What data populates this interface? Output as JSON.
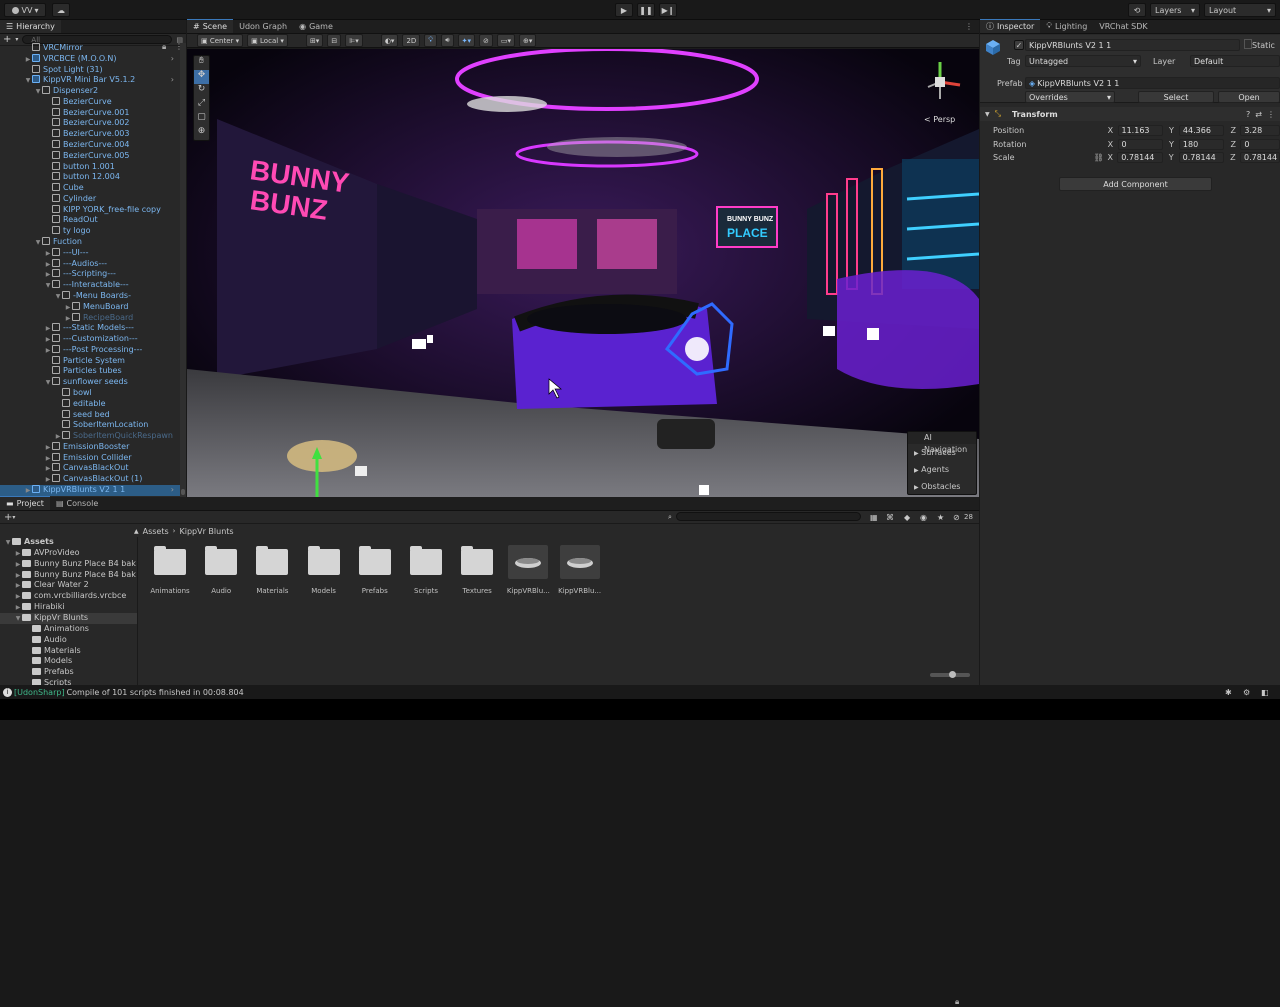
{
  "topbar": {
    "account": "VV",
    "layers": "Layers",
    "layout": "Layout"
  },
  "hierarchy": {
    "tab": "Hierarchy",
    "search_placeholder": "All",
    "items": [
      {
        "label": "VRCMirror",
        "indent": 3
      },
      {
        "label": "VRCBCE (M.O.O.N)",
        "indent": 3,
        "prefab": true,
        "arrow": "▶"
      },
      {
        "label": "Spot Light (31)",
        "indent": 3
      },
      {
        "label": "KippVR Mini Bar V5.1.2",
        "indent": 3,
        "prefab": true,
        "arrow": "▼"
      },
      {
        "label": "Dispenser2",
        "indent": 4,
        "arrow": "▼"
      },
      {
        "label": "BezierCurve",
        "indent": 5
      },
      {
        "label": "BezierCurve.001",
        "indent": 5
      },
      {
        "label": "BezierCurve.002",
        "indent": 5
      },
      {
        "label": "BezierCurve.003",
        "indent": 5
      },
      {
        "label": "BezierCurve.004",
        "indent": 5
      },
      {
        "label": "BezierCurve.005",
        "indent": 5
      },
      {
        "label": "button 1.001",
        "indent": 5
      },
      {
        "label": "button 12.004",
        "indent": 5
      },
      {
        "label": "Cube",
        "indent": 5
      },
      {
        "label": "Cylinder",
        "indent": 5
      },
      {
        "label": "KIPP YORK_free-file copy",
        "indent": 5
      },
      {
        "label": "ReadOut",
        "indent": 5
      },
      {
        "label": "ty logo",
        "indent": 5
      },
      {
        "label": "Fuction",
        "indent": 4,
        "arrow": "▼"
      },
      {
        "label": "---UI---",
        "indent": 5,
        "arrow": "▶"
      },
      {
        "label": "---Audios---",
        "indent": 5,
        "arrow": "▶"
      },
      {
        "label": "---Scripting---",
        "indent": 5,
        "arrow": "▶"
      },
      {
        "label": "---Interactable---",
        "indent": 5,
        "arrow": "▼"
      },
      {
        "label": "-Menu Boards-",
        "indent": 6,
        "arrow": "▼"
      },
      {
        "label": "MenuBoard",
        "indent": 7,
        "arrow": "▶"
      },
      {
        "label": "RecipeBoard",
        "indent": 7,
        "arrow": "▶",
        "dim": true
      },
      {
        "label": "---Static Models---",
        "indent": 5,
        "arrow": "▶"
      },
      {
        "label": "---Customization---",
        "indent": 5,
        "arrow": "▶"
      },
      {
        "label": "---Post Processing---",
        "indent": 5,
        "arrow": "▶"
      },
      {
        "label": "Particle System",
        "indent": 5
      },
      {
        "label": "Particles tubes",
        "indent": 5
      },
      {
        "label": "sunflower seeds",
        "indent": 5,
        "arrow": "▼"
      },
      {
        "label": "bowl",
        "indent": 6
      },
      {
        "label": "editable",
        "indent": 6
      },
      {
        "label": "seed bed",
        "indent": 6
      },
      {
        "label": "SoberItemLocation",
        "indent": 6
      },
      {
        "label": "SoberItemQuickRespawn",
        "indent": 6,
        "arrow": "▶",
        "dim": true
      },
      {
        "label": "EmissionBooster",
        "indent": 5,
        "arrow": "▶"
      },
      {
        "label": "Emission Collider",
        "indent": 5,
        "arrow": "▶"
      },
      {
        "label": "CanvasBlackOut",
        "indent": 5,
        "arrow": "▶"
      },
      {
        "label": "CanvasBlackOut (1)",
        "indent": 5,
        "arrow": "▶"
      },
      {
        "label": "KippVRBlunts V2 1 1",
        "indent": 3,
        "prefab": true,
        "arrow": "▶",
        "selected": true
      }
    ]
  },
  "scene": {
    "tabs": [
      "Scene",
      "Udon Graph",
      "Game"
    ],
    "pivot": "Center",
    "space": "Local",
    "mode2d": "2D",
    "persp": "< Persp",
    "overlay_title": "AI Navigation",
    "overlay_items": [
      "Surfaces",
      "Agents",
      "Obstacles"
    ],
    "signs": [
      "BUNNY",
      "BUNZ",
      "BUNNY BUNZ",
      "PLACE"
    ]
  },
  "inspector": {
    "tabs": [
      "Inspector",
      "Lighting",
      "VRChat SDK"
    ],
    "object_name": "KippVRBlunts V2 1 1",
    "static_label": "Static",
    "tag_label": "Tag",
    "tag_value": "Untagged",
    "layer_label": "Layer",
    "layer_value": "Default",
    "prefab_label": "Prefab",
    "prefab_value": "KippVRBlunts V2 1 1",
    "overrides": "Overrides",
    "select": "Select",
    "open": "Open",
    "component": "Transform",
    "position_label": "Position",
    "rotation_label": "Rotation",
    "scale_label": "Scale",
    "x": "X",
    "y": "Y",
    "z": "Z",
    "position": [
      "11.163",
      "44.366",
      "3.28"
    ],
    "rotation": [
      "0",
      "180",
      "0"
    ],
    "scale": [
      "0.78144",
      "0.78144",
      "0.78144"
    ],
    "add_component": "Add Component"
  },
  "project": {
    "tabs": [
      "Project",
      "Console"
    ],
    "breadcrumb": [
      "Assets",
      "KippVr Blunts"
    ],
    "count": "28",
    "tree": [
      {
        "label": "Assets",
        "indent": 0,
        "bold": true
      },
      {
        "label": "AVProVideo",
        "indent": 1
      },
      {
        "label": "Bunny Bunz Place B4 bak",
        "indent": 1
      },
      {
        "label": "Bunny Bunz Place B4 bak",
        "indent": 1
      },
      {
        "label": "Clear Water 2",
        "indent": 1
      },
      {
        "label": "com.vrcbilliards.vrcbce",
        "indent": 1
      },
      {
        "label": "Hirabiki",
        "indent": 1
      },
      {
        "label": "KippVr Blunts",
        "indent": 1,
        "selected": true
      },
      {
        "label": "Animations",
        "indent": 2
      },
      {
        "label": "Audio",
        "indent": 2
      },
      {
        "label": "Materials",
        "indent": 2
      },
      {
        "label": "Models",
        "indent": 2
      },
      {
        "label": "Prefabs",
        "indent": 2
      },
      {
        "label": "Scripts",
        "indent": 2
      }
    ],
    "assets": [
      {
        "label": "Animations",
        "kind": "folder"
      },
      {
        "label": "Audio",
        "kind": "folder"
      },
      {
        "label": "Materials",
        "kind": "folder"
      },
      {
        "label": "Models",
        "kind": "folder"
      },
      {
        "label": "Prefabs",
        "kind": "folder"
      },
      {
        "label": "Scripts",
        "kind": "folder"
      },
      {
        "label": "Textures",
        "kind": "folder"
      },
      {
        "label": "KippVRBlu...",
        "kind": "prefab"
      },
      {
        "label": "KippVRBlu...",
        "kind": "prefab"
      }
    ]
  },
  "status": {
    "source": "[UdonSharp]",
    "message": "Compile of 101 scripts finished in 00:08.804"
  }
}
